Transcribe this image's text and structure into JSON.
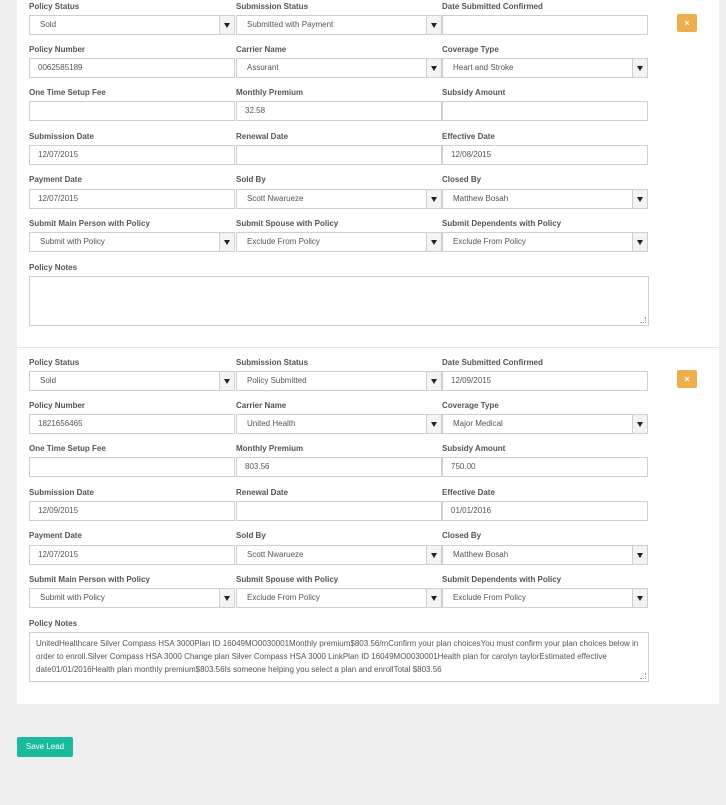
{
  "policies": [
    {
      "labels": {
        "policy_status": "Policy Status",
        "submission_status": "Submission Status",
        "date_submitted_confirmed": "Date Submitted Confirmed",
        "policy_number": "Policy Number",
        "carrier_name": "Carrier Name",
        "coverage_type": "Coverage Type",
        "one_time_setup_fee": "One Time Setup Fee",
        "monthly_premium": "Monthly Premium",
        "subsidy_amount": "Subsidy Amount",
        "submission_date": "Submission Date",
        "renewal_date": "Renewal Date",
        "effective_date": "Effective Date",
        "payment_date": "Payment Date",
        "sold_by": "Sold By",
        "closed_by": "Closed By",
        "submit_main": "Submit Main Person with Policy",
        "submit_spouse": "Submit Spouse with Policy",
        "submit_dependents": "Submit Dependents with Policy",
        "policy_notes": "Policy Notes"
      },
      "values": {
        "policy_status": "Sold",
        "submission_status": "Submitted with Payment",
        "date_submitted_confirmed": "",
        "policy_number": "0062585189",
        "carrier_name": "Assurant",
        "coverage_type": "Heart and Stroke",
        "one_time_setup_fee": "",
        "monthly_premium": "32.58",
        "subsidy_amount": "",
        "submission_date": "12/07/2015",
        "renewal_date": "",
        "effective_date": "12/08/2015",
        "payment_date": "12/07/2015",
        "sold_by": "Scott Nwarueze",
        "closed_by": "Matthew Bosah",
        "submit_main": "Submit with Policy",
        "submit_spouse": "Exclude From Policy",
        "submit_dependents": "Exclude From Policy",
        "policy_notes": ""
      },
      "remove_label": "×"
    },
    {
      "labels": {
        "policy_status": "Policy Status",
        "submission_status": "Submission Status",
        "date_submitted_confirmed": "Date Submitted Confirmed",
        "policy_number": "Policy Number",
        "carrier_name": "Carrier Name",
        "coverage_type": "Coverage Type",
        "one_time_setup_fee": "One Time Setup Fee",
        "monthly_premium": "Monthly Premium",
        "subsidy_amount": "Subsidy Amount",
        "submission_date": "Submission Date",
        "renewal_date": "Renewal Date",
        "effective_date": "Effective Date",
        "payment_date": "Payment Date",
        "sold_by": "Sold By",
        "closed_by": "Closed By",
        "submit_main": "Submit Main Person with Policy",
        "submit_spouse": "Submit Spouse with Policy",
        "submit_dependents": "Submit Dependents with Policy",
        "policy_notes": "Policy Notes"
      },
      "values": {
        "policy_status": "Sold",
        "submission_status": "Policy Submitted",
        "date_submitted_confirmed": "12/09/2015",
        "policy_number": "1821656465",
        "carrier_name": "United Health",
        "coverage_type": "Major Medical",
        "one_time_setup_fee": "",
        "monthly_premium": "803.56",
        "subsidy_amount": "750.00",
        "submission_date": "12/09/2015",
        "renewal_date": "",
        "effective_date": "01/01/2016",
        "payment_date": "12/07/2015",
        "sold_by": "Scott Nwarueze",
        "closed_by": "Matthew Bosah",
        "submit_main": "Submit with Policy",
        "submit_spouse": "Exclude From Policy",
        "submit_dependents": "Exclude From Policy",
        "policy_notes": "UnitedHealthcare Silver Compass HSA 3000Plan ID 16049MO0030001Monthly premium$803.56/mConfirm your plan choicesYou must confirm your plan choices below in order to enroll.Silver Compass HSA 3000 Change plan Silver Compass HSA 3000 LinkPlan ID 16049MO0030001Health plan for    carolyn taylorEstimated effective date01/01/2016Health plan monthly premium$803.56Is someone helping you select a plan and enrollTotal $803.56"
      },
      "remove_label": "×"
    }
  ],
  "save_button": {
    "label": "Save Lead"
  }
}
